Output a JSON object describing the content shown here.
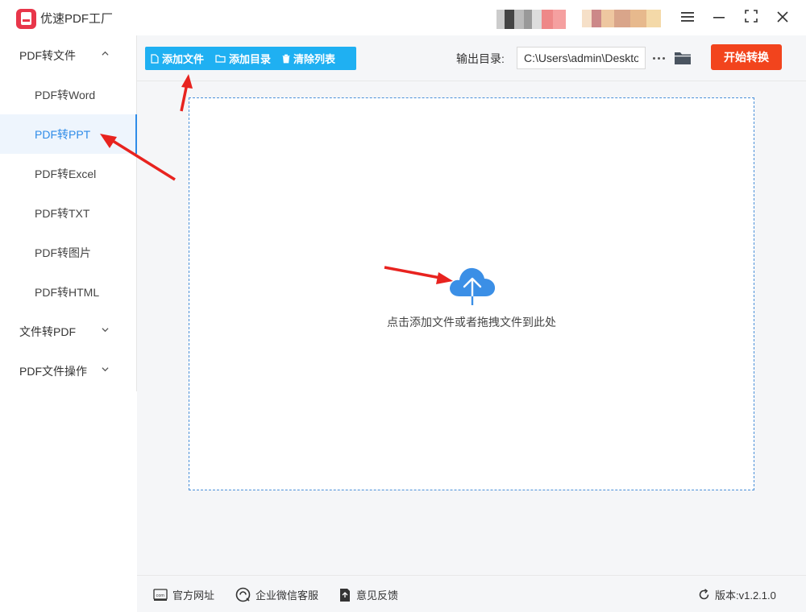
{
  "app": {
    "title": "优速PDF工厂"
  },
  "sidebar": {
    "groups": [
      {
        "label": "PDF转文件",
        "expanded": true,
        "items": [
          {
            "label": "PDF转Word"
          },
          {
            "label": "PDF转PPT",
            "active": true
          },
          {
            "label": "PDF转Excel"
          },
          {
            "label": "PDF转TXT"
          },
          {
            "label": "PDF转图片"
          },
          {
            "label": "PDF转HTML"
          }
        ]
      },
      {
        "label": "文件转PDF",
        "expanded": false
      },
      {
        "label": "PDF文件操作",
        "expanded": false
      }
    ]
  },
  "toolbar": {
    "add_file": "添加文件",
    "add_folder": "添加目录",
    "clear_list": "清除列表",
    "output_label": "输出目录:",
    "output_path": "C:\\Users\\admin\\Deskto",
    "start": "开始转换"
  },
  "dropzone": {
    "hint": "点击添加文件或者拖拽文件到此处"
  },
  "footer": {
    "website": "官方网址",
    "wechat": "企业微信客服",
    "feedback": "意见反馈",
    "version": "版本:v1.2.1.0"
  },
  "colors": {
    "accent": "#1fb0f2",
    "active": "#2f8ce8",
    "start": "#f2441d",
    "annotation": "#e8231f"
  }
}
